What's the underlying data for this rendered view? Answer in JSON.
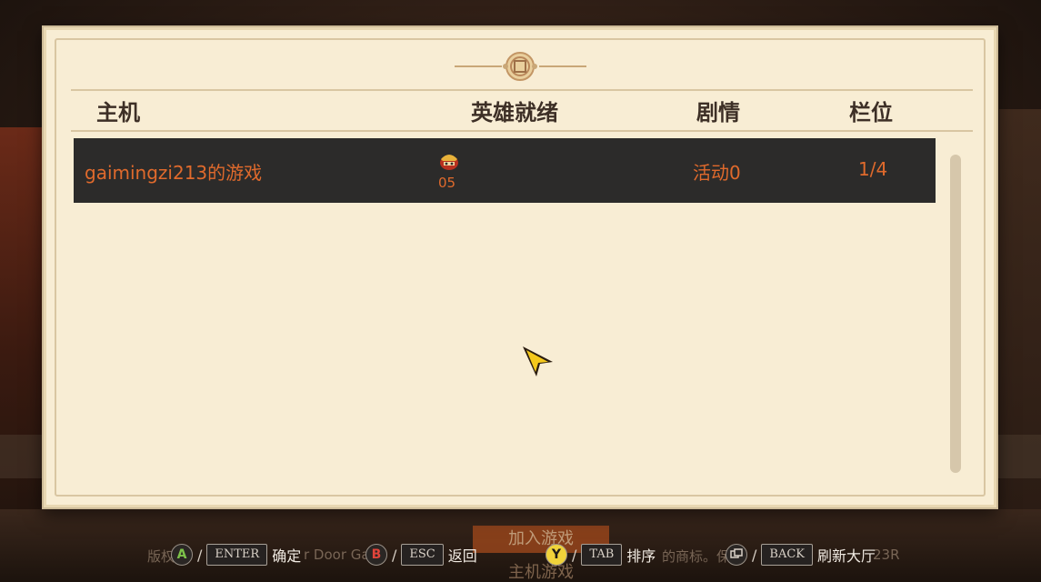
{
  "columns": {
    "host": "主机",
    "heroes_ready": "英雄就绪",
    "story": "剧情",
    "slots": "栏位"
  },
  "lobby_rows": [
    {
      "host_name": "gaimingzi213的游戏",
      "heroes_ready_count": "05",
      "story": "活动0",
      "slots": "1/4"
    }
  ],
  "background": {
    "join_game": "加入游戏",
    "host_game": "主机游戏",
    "copyright_fragments": [
      "版权",
      "r Door Ga",
      "的商标。保",
      "23R"
    ]
  },
  "controls": [
    {
      "gamepad_button": "A",
      "gamepad_color": "#7dc24a",
      "key": "ENTER",
      "action": "确定"
    },
    {
      "gamepad_button": "B",
      "gamepad_color": "#e0443a",
      "key": "ESC",
      "action": "返回"
    },
    {
      "gamepad_button": "Y",
      "gamepad_color": "#f0d23a",
      "key": "TAB",
      "action": "排序"
    },
    {
      "gamepad_button": "view-icon",
      "gamepad_color": "#d9d1c7",
      "key": "BACK",
      "action": "刷新大厅"
    }
  ],
  "colors": {
    "parchment": "#f8edd4",
    "row_bg": "#2c2b2a",
    "row_text": "#e06a2c",
    "header_text": "#3d2f26"
  }
}
